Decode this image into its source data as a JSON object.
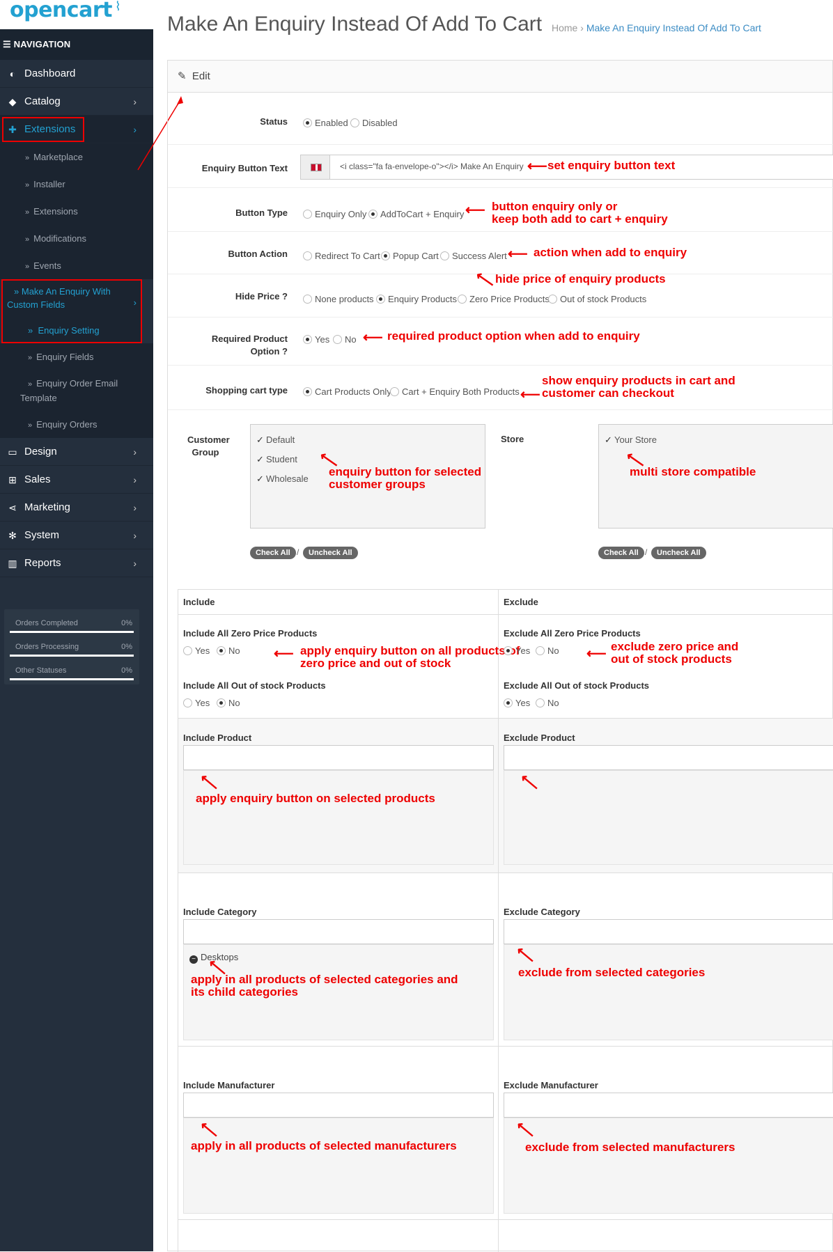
{
  "logo": {
    "text": "opencart"
  },
  "sidebar": {
    "nav_header": "NAVIGATION",
    "items": [
      {
        "label": "Dashboard",
        "icon": "dashboard-icon"
      },
      {
        "label": "Catalog",
        "icon": "tags-icon"
      },
      {
        "label": "Extensions",
        "icon": "puzzle-icon"
      },
      {
        "label": "Design",
        "icon": "desktop-icon"
      },
      {
        "label": "Sales",
        "icon": "cart-icon"
      },
      {
        "label": "Marketing",
        "icon": "share-icon"
      },
      {
        "label": "System",
        "icon": "cog-icon"
      },
      {
        "label": "Reports",
        "icon": "bar-chart-icon"
      }
    ],
    "extensions_sub": [
      "Marketplace",
      "Installer",
      "Extensions",
      "Modifications",
      "Events"
    ],
    "enquiry_group": "Make An Enquiry With Custom Fields",
    "enquiry_sub": [
      "Enquiry Setting",
      "Enquiry Fields",
      "Enquiry Order Email Template",
      "Enquiry Orders"
    ],
    "stats": [
      {
        "label": "Orders Completed",
        "value": "0%"
      },
      {
        "label": "Orders Processing",
        "value": "0%"
      },
      {
        "label": "Other Statuses",
        "value": "0%"
      }
    ]
  },
  "header": {
    "title": "Make An Enquiry Instead Of Add To Cart",
    "breadcrumb_home": "Home",
    "breadcrumb_sep": "›",
    "breadcrumb_current": "Make An Enquiry Instead Of Add To Cart"
  },
  "panel": {
    "heading": "Edit"
  },
  "form": {
    "status": {
      "label": "Status",
      "options": [
        "Enabled",
        "Disabled"
      ],
      "selected": "Enabled"
    },
    "button_text": {
      "label": "Enquiry Button Text",
      "value": "<i class=\"fa fa-envelope-o\"></i> Make An Enquiry"
    },
    "button_type": {
      "label": "Button Type",
      "options": [
        "Enquiry Only",
        "AddToCart + Enquiry"
      ],
      "selected": "AddToCart + Enquiry"
    },
    "button_action": {
      "label": "Button Action",
      "options": [
        "Redirect To Cart",
        "Popup Cart",
        "Success Alert"
      ],
      "selected": "Popup Cart"
    },
    "hide_price": {
      "label": "Hide Price ?",
      "options": [
        "None products",
        "Enquiry Products",
        "Zero Price Products",
        "Out of stock Products"
      ],
      "selected": "Enquiry Products"
    },
    "required_option": {
      "label_line1": "Required Product",
      "label_line2": "Option ?",
      "options": [
        "Yes",
        "No"
      ],
      "selected": "Yes"
    },
    "cart_type": {
      "label": "Shopping cart type",
      "options": [
        "Cart Products Only",
        "Cart + Enquiry Both Products"
      ],
      "selected": "Cart Products Only"
    },
    "customer_group": {
      "label_line1": "Customer",
      "label_line2": "Group",
      "items": [
        "Default",
        "Student",
        "Wholesale"
      ]
    },
    "store": {
      "label": "Store",
      "items": [
        "Your Store"
      ]
    },
    "check_all": "Check All",
    "uncheck_all": "Uncheck All",
    "slash": "/"
  },
  "rules": {
    "include_title": "Include",
    "exclude_title": "Exclude",
    "inc_zero": {
      "label": "Include All Zero Price Products",
      "options": [
        "Yes",
        "No"
      ],
      "selected": "No"
    },
    "exc_zero": {
      "label": "Exclude All Zero Price Products",
      "options": [
        "Yes",
        "No"
      ],
      "selected": "Yes"
    },
    "inc_oos": {
      "label": "Include All Out of stock Products",
      "options": [
        "Yes",
        "No"
      ],
      "selected": "No"
    },
    "exc_oos": {
      "label": "Exclude All Out of stock Products",
      "options": [
        "Yes",
        "No"
      ],
      "selected": "Yes"
    },
    "inc_product": "Include Product",
    "exc_product": "Exclude Product",
    "inc_category": "Include Category",
    "exc_category": "Exclude Category",
    "inc_category_tag": "Desktops",
    "inc_manufacturer": "Include Manufacturer",
    "exc_manufacturer": "Exclude Manufacturer"
  },
  "annotations": {
    "button_text": "set enquiry button text",
    "button_type_1": "button enquiry only or",
    "button_type_2": "keep both add to cart + enquiry",
    "button_action": "action when add to enquiry",
    "hide_price": "hide price of enquiry products",
    "required_option": "required product option when add to enquiry",
    "cart_type_1": "show enquiry products in cart and",
    "cart_type_2": "customer can checkout",
    "customer_group_1": "enquiry button for selected",
    "customer_group_2": "customer groups",
    "store": "multi store compatible",
    "include_zero_1": "apply enquiry button on all products of",
    "include_zero_2": "zero price and out of stock",
    "exclude_zero_1": "exclude zero price and",
    "exclude_zero_2": "out of stock products",
    "include_product": "apply enquiry button on selected products",
    "include_category_1": "apply in all products of selected categories and",
    "include_category_2": "its child categories",
    "exclude_category": "exclude from selected categories",
    "include_manufacturer": "apply in all products of selected manufacturers",
    "exclude_manufacturer": "exclude from selected manufacturers"
  },
  "colors": {
    "accent": "#23a1d1",
    "sidebar_bg": "#242f3d",
    "annotation": "#e00000",
    "link": "#3b8cc4"
  }
}
